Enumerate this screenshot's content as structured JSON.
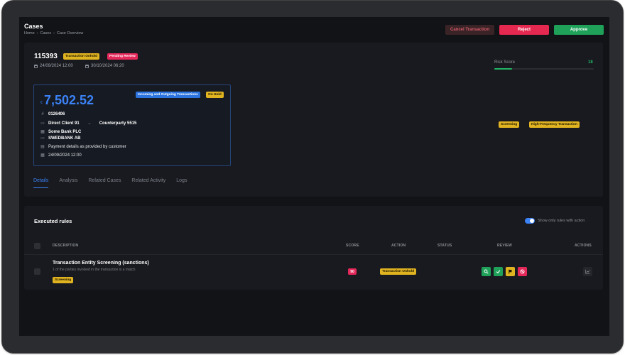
{
  "header": {
    "title": "Cases",
    "breadcrumb": [
      "Home",
      "Cases",
      "Case Overview"
    ],
    "cancel_label": "Cancel Transaction",
    "reject_label": "Reject",
    "approve_label": "Approve"
  },
  "case": {
    "id": "115393",
    "badges": [
      "Transaction Onhold",
      "Pending Review"
    ],
    "created": "24/09/2024 12:00",
    "updated": "30/10/2024 06:20",
    "risk_label": "Risk Score",
    "risk_score": "18",
    "risk_fraction": 0.18,
    "tags": [
      "Screening",
      "High-Frequency Transaction"
    ]
  },
  "transaction": {
    "currency": "€",
    "amount": "7,502.52",
    "direction_badge": "Incoming and Outgoing Transactions",
    "status_badge": "On Hold",
    "reference": "0126406",
    "from": "Direct Client 91",
    "to": "Counterparty 5515",
    "bank_from": "Some Bank PLC",
    "bank_to": "SWEDBANK AB",
    "details": "Payment details as provided by customer",
    "date": "24/09/2024 12:00"
  },
  "tabs": [
    "Details",
    "Analysis",
    "Related Cases",
    "Related Activity",
    "Logs"
  ],
  "rules": {
    "title": "Executed rules",
    "toggle_label": "Show only rules with action",
    "columns": [
      "DESCRIPTION",
      "SCORE",
      "ACTION",
      "STATUS",
      "REVIEW",
      "ACTIONS"
    ],
    "rows": [
      {
        "name": "Transaction Entity Screening (sanctions)",
        "description": "1 of the parties involved in the transaction is a match.",
        "tag": "Screening",
        "score": "90",
        "action": "Transaction Onhold",
        "status": ""
      }
    ]
  },
  "colors": {
    "accent": "#3b82f6",
    "approve": "#1fa15a",
    "reject": "#e5284f",
    "warning": "#e0b321"
  }
}
